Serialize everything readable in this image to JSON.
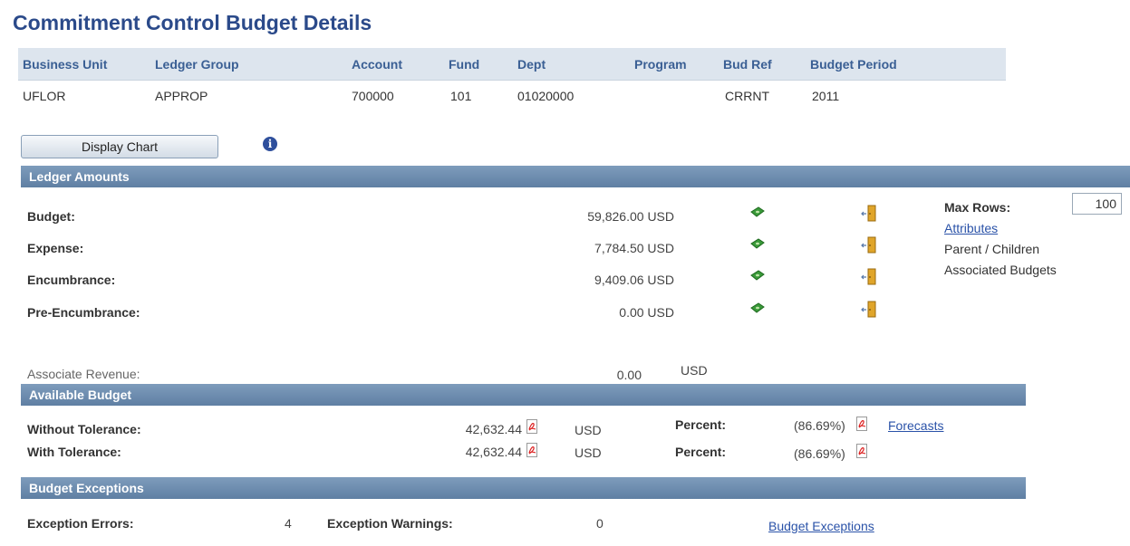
{
  "page": {
    "title": "Commitment Control Budget Details"
  },
  "keys": {
    "headers": [
      "Business Unit",
      "Ledger Group",
      "Account",
      "Fund",
      "Dept",
      "Program",
      "Bud Ref",
      "Budget Period"
    ],
    "values": [
      "UFLOR",
      "APPROP",
      "700000",
      "101",
      "01020000",
      "",
      "CRRNT",
      "2011"
    ]
  },
  "display_chart_label": "Display Chart",
  "info_icon_glyph": "i",
  "ledger": {
    "title": "Ledger Amounts",
    "rows": [
      {
        "label": "Budget:",
        "amount": "59,826.00 USD"
      },
      {
        "label": "Expense:",
        "amount": "7,784.50 USD"
      },
      {
        "label": "Encumbrance:",
        "amount": "9,409.06 USD"
      },
      {
        "label": "Pre-Encumbrance:",
        "amount": "0.00 USD"
      }
    ],
    "max_rows_label": "Max Rows:",
    "max_rows_value": "100",
    "attributes_link": "Attributes",
    "parent_children": "Parent / Children",
    "associated_budgets": "Associated Budgets",
    "assoc_revenue_label": "Associate Revenue:",
    "assoc_revenue_value": "0.00",
    "assoc_revenue_currency": "USD"
  },
  "available": {
    "title": "Available Budget",
    "rows": [
      {
        "label": "Without Tolerance:",
        "amount": "42,632.44",
        "currency": "USD",
        "percent_label": "Percent:",
        "percent": "(86.69%)"
      },
      {
        "label": "With Tolerance:",
        "amount": "42,632.44",
        "currency": "USD",
        "percent_label": "Percent:",
        "percent": "(86.69%)"
      }
    ],
    "forecasts_link": "Forecasts"
  },
  "exceptions": {
    "title": "Budget Exceptions",
    "errors_label": "Exception Errors:",
    "errors_value": "4",
    "warnings_label": "Exception Warnings:",
    "warnings_value": "0",
    "link": "Budget Exceptions"
  },
  "colors": {
    "title": "#2b4a8a",
    "section_bar": "#6f8daf",
    "link": "#2a52a8",
    "key_bar": "#dde5ee"
  },
  "icons": {
    "money": "money-icon",
    "door": "drilldown-door-icon",
    "pdf": "pdf-report-icon",
    "info": "info-icon"
  }
}
